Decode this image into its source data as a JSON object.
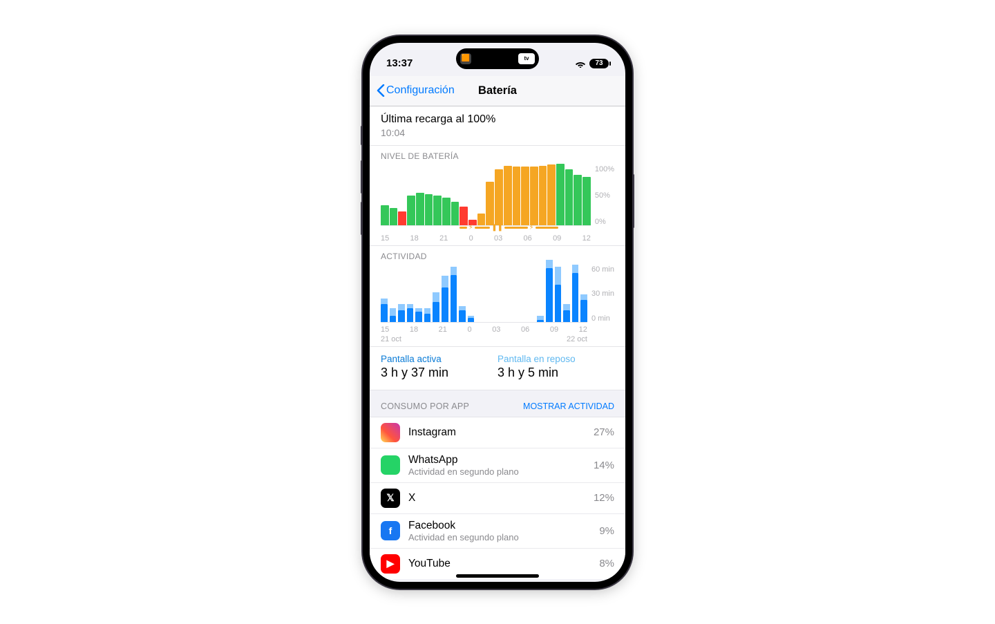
{
  "status": {
    "time": "13:37",
    "battery_pct": "73",
    "tv_badge": "tv"
  },
  "nav": {
    "back": "Configuración",
    "title": "Batería"
  },
  "last_charge": {
    "title": "Última recarga al 100%",
    "time": "10:04"
  },
  "battery_level": {
    "label": "NIVEL DE BATERÍA",
    "x_ticks": [
      "15",
      "18",
      "21",
      "0",
      "03",
      "06",
      "09",
      "12"
    ],
    "y_ticks": [
      "100%",
      "50%",
      "0%"
    ]
  },
  "activity": {
    "label": "ACTIVIDAD",
    "x_ticks": [
      "15",
      "18",
      "21",
      "0",
      "03",
      "06",
      "09",
      "12"
    ],
    "x_dates": [
      "21 oct",
      "22 oct"
    ],
    "y_ticks": [
      "60 min",
      "30 min",
      "0 min"
    ]
  },
  "screen_time": {
    "active_label": "Pantalla activa",
    "active_value": "3 h y 37 min",
    "idle_label": "Pantalla en reposo",
    "idle_value": "3 h y 5 min"
  },
  "consumption": {
    "header": "CONSUMO POR APP",
    "toggle": "MOSTRAR ACTIVIDAD",
    "bg_label": "Actividad en segundo plano",
    "apps": [
      {
        "name": "Instagram",
        "pct": "27%",
        "bg": false
      },
      {
        "name": "WhatsApp",
        "pct": "14%",
        "bg": true
      },
      {
        "name": "X",
        "pct": "12%",
        "bg": false
      },
      {
        "name": "Facebook",
        "pct": "9%",
        "bg": true
      },
      {
        "name": "YouTube",
        "pct": "8%",
        "bg": false
      }
    ]
  },
  "colors": {
    "green": "#34c759",
    "orange": "#f5a623",
    "red": "#ff3b30",
    "blue": "#0a84ff",
    "lightblue": "#8fcaff"
  },
  "chart_data": [
    {
      "type": "bar",
      "title": "NIVEL DE BATERÍA",
      "xlabel": "",
      "ylabel": "%",
      "ylim": [
        0,
        100
      ],
      "categories_hours": [
        14,
        15,
        16,
        17,
        18,
        19,
        20,
        21,
        22,
        23,
        0,
        1,
        2,
        3,
        4,
        5,
        6,
        7,
        8,
        9,
        10,
        11,
        12,
        13
      ],
      "series": [
        {
          "name": "level_pct",
          "values": [
            32,
            28,
            22,
            48,
            52,
            50,
            48,
            44,
            38,
            30,
            8,
            18,
            70,
            90,
            96,
            95,
            95,
            95,
            96,
            98,
            100,
            90,
            82,
            78
          ]
        },
        {
          "name": "state",
          "values": [
            "g",
            "g",
            "r",
            "g",
            "g",
            "g",
            "g",
            "g",
            "g",
            "r",
            "r",
            "o",
            "o",
            "o",
            "o",
            "o",
            "o",
            "o",
            "o",
            "o",
            "g",
            "g",
            "g",
            "g"
          ],
          "legend": {
            "g": "discharging",
            "o": "charging",
            "r": "low"
          }
        }
      ]
    },
    {
      "type": "bar",
      "title": "ACTIVIDAD",
      "xlabel": "",
      "ylabel": "min",
      "ylim": [
        0,
        60
      ],
      "categories_hours": [
        14,
        15,
        16,
        17,
        18,
        19,
        20,
        21,
        22,
        23,
        0,
        1,
        2,
        3,
        4,
        5,
        6,
        7,
        8,
        9,
        10,
        11,
        12,
        13
      ],
      "series": [
        {
          "name": "screen_on_min",
          "values": [
            18,
            6,
            12,
            14,
            10,
            8,
            20,
            35,
            48,
            12,
            4,
            0,
            0,
            0,
            0,
            0,
            0,
            0,
            2,
            55,
            38,
            12,
            50,
            22
          ]
        },
        {
          "name": "screen_off_min",
          "values": [
            6,
            8,
            6,
            4,
            4,
            6,
            10,
            12,
            8,
            4,
            2,
            0,
            0,
            0,
            0,
            0,
            0,
            0,
            4,
            8,
            18,
            6,
            8,
            6
          ]
        }
      ]
    }
  ]
}
